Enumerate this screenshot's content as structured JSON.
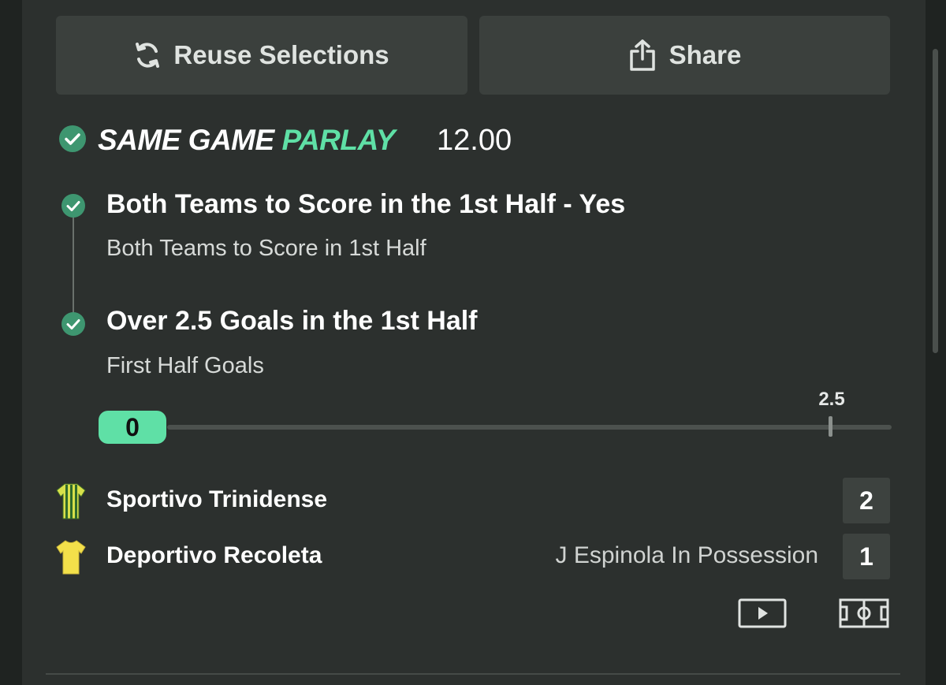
{
  "actions": {
    "reuse_label": "Reuse Selections",
    "share_label": "Share"
  },
  "bet": {
    "type_word_1": "SAME GAME ",
    "type_word_2": "PARLAY",
    "odds": "12.00",
    "legs": [
      {
        "title": "Both Teams to Score in the 1st Half - Yes",
        "market": "Both Teams to Score in 1st Half"
      },
      {
        "title": "Over 2.5 Goals in the 1st Half",
        "market": "First Half Goals"
      }
    ],
    "tracker": {
      "current": "0",
      "line": "2.5"
    }
  },
  "match": {
    "home": {
      "name": "Sportivo Trinidense",
      "score": "2"
    },
    "away": {
      "name": "Deportivo Recoleta",
      "score": "1"
    },
    "status": "J Espinola In Possession"
  },
  "icons": {
    "reuse": "refresh-icon",
    "share": "share-icon",
    "video": "play-video-icon",
    "pitch": "pitch-view-icon"
  },
  "colors": {
    "accent": "#5fe0a6",
    "check": "#3e9670",
    "panel": "#2c302e",
    "button": "#3b403d"
  }
}
